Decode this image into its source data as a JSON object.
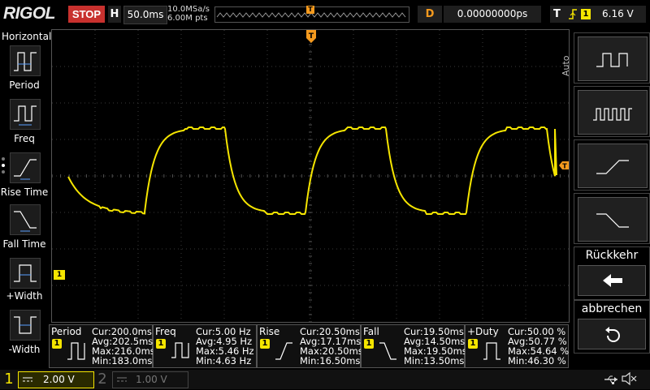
{
  "top_bar": {
    "logo": "RIGOL",
    "run_state": "STOP",
    "horizontal_key": "H",
    "timebase": "50.0ms",
    "sample_rate": "10.0MSa/s",
    "memory_depth": "6.00M pts",
    "delay_key": "D",
    "delay_value": "0.00000000ps",
    "trigger_key": "T",
    "trigger_source": "1",
    "trigger_level": "6.16 V",
    "trigger_marker": "T"
  },
  "left_panel": {
    "title": "Horizontal",
    "items": [
      {
        "label": "Period"
      },
      {
        "label": "Freq"
      },
      {
        "label": "Rise Time"
      },
      {
        "label": "Fall Time"
      },
      {
        "label": "+Width"
      },
      {
        "label": "-Width"
      }
    ]
  },
  "right_menu": {
    "auto_label": "Auto",
    "back_label": "Rückkehr",
    "cancel_label": "abbrechen"
  },
  "waveform": {
    "channel_marker": "1",
    "trigger_level_marker": "T"
  },
  "measurements": [
    {
      "name": "Period",
      "cur": "Cur:200.0ms",
      "avg": "Avg:202.5ms",
      "max": "Max:216.0ms",
      "min": "Min:183.0ms"
    },
    {
      "name": "Freq",
      "cur": "Cur:5.00 Hz",
      "avg": "Avg:4.95 Hz",
      "max": "Max:5.46 Hz",
      "min": "Min:4.63 Hz"
    },
    {
      "name": "Rise",
      "cur": "Cur:20.50ms",
      "avg": "Avg:17.17ms",
      "max": "Max:20.50ms",
      "min": "Min:16.50ms"
    },
    {
      "name": "Fall",
      "cur": "Cur:19.50ms",
      "avg": "Avg:14.50ms",
      "max": "Max:19.50ms",
      "min": "Min:13.50ms"
    },
    {
      "name": "+Duty",
      "cur": "Cur:50.00 %",
      "avg": "Avg:50.77 %",
      "max": "Max:54.64 %",
      "min": "Min:46.30 %"
    }
  ],
  "measurement_channel": "1",
  "status_bar": {
    "ch1_number": "1",
    "ch1_scale": "2.00 V",
    "ch2_number": "2",
    "ch2_scale": "1.00 V"
  },
  "colors": {
    "ch1": "#f5e500",
    "trigger": "#f59a1e",
    "stop": "#c8312e"
  }
}
